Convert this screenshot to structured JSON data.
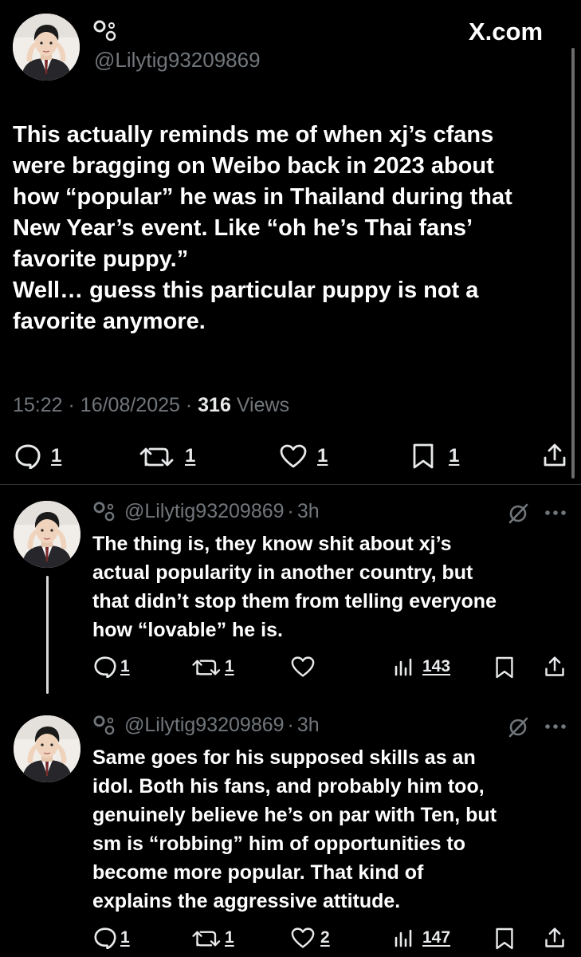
{
  "brand": {
    "site": "X.com"
  },
  "main_post": {
    "handle": "@Lilytig93209869",
    "name_glyph": "°௚",
    "lines": [
      "This actually reminds me of when xj’s cfans",
      "were bragging on Weibo back in 2023 about",
      "how “popular” he was in Thailand during that",
      "New Year’s event. Like “oh he’s Thai fans’",
      "favorite puppy.”",
      "Well… guess this particular puppy is not a",
      "favorite anymore."
    ],
    "time": "15:22",
    "date": "16/08/2025",
    "views_count": "316",
    "views_label": "Views",
    "sep": "·",
    "actions": {
      "replies": "1",
      "reposts": "1",
      "likes": "1",
      "bookmarks": "1"
    }
  },
  "replies": [
    {
      "handle": "@Lilytig93209869",
      "age": "3h",
      "lines": [
        "The thing is, they know shit about xj’s",
        "actual popularity in another country, but",
        "that didn’t stop them from telling everyone",
        "how “lovable” he is."
      ],
      "actions": {
        "replies": "1",
        "reposts": "1",
        "likes": "",
        "views": "143"
      }
    },
    {
      "handle": "@Lilytig93209869",
      "age": "3h",
      "lines": [
        "Same goes for his supposed skills as an",
        "idol. Both his fans, and probably him too,",
        "genuinely believe he’s on par with Ten, but",
        "sm is “robbing” him of opportunities to",
        "become more popular. That kind of",
        "explains the aggressive attitude."
      ],
      "actions": {
        "replies": "1",
        "reposts": "1",
        "likes": "2",
        "views": "147"
      }
    }
  ],
  "icons": {
    "reply": "reply-icon",
    "repost": "repost-icon",
    "like": "heart-icon",
    "bookmark": "bookmark-icon",
    "share": "share-icon",
    "views": "analytics-icon",
    "grok": "grok-icon",
    "more": "more-icon"
  },
  "colors": {
    "background": "#000000",
    "text": "#e7e9ea",
    "secondary": "#71767b",
    "divider": "#2f3336"
  }
}
